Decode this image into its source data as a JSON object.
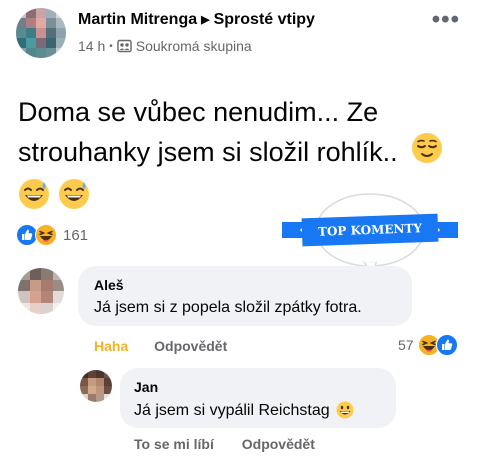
{
  "post": {
    "author": "Martin Mitrenga",
    "group": "Sprosté vtipy",
    "time": "14 h",
    "separator": "•",
    "audience": "Soukromá skupina",
    "text_line1": "Doma se vůbec nenudim... Ze",
    "text_line2": "strouhanky jsem si složil rohlík.."
  },
  "reactions": {
    "count": "161"
  },
  "badge": {
    "label": "TOP KOMENTY",
    "color": "#1877f2"
  },
  "comments": [
    {
      "author": "Aleš",
      "text": "Já jsem si z popela složil zpátky fotra.",
      "reaction_label": "Haha",
      "reply_label": "Odpovědět",
      "reaction_count": "57"
    },
    {
      "author": "Jan",
      "text": "Já jsem si vypálil Reichstag",
      "like_label": "To se mi líbí",
      "reply_label": "Odpovědět"
    }
  ],
  "colors": {
    "facebook_blue": "#1877f2",
    "haha_yellow": "#f7b125",
    "muted": "#65676b",
    "bubble": "#f0f2f5"
  },
  "icons": [
    "group-privacy-icon",
    "like-reaction-icon",
    "haha-reaction-icon",
    "relieved-emoji",
    "sweat-smile-emoji",
    "grinning-emoji",
    "more-icon"
  ]
}
